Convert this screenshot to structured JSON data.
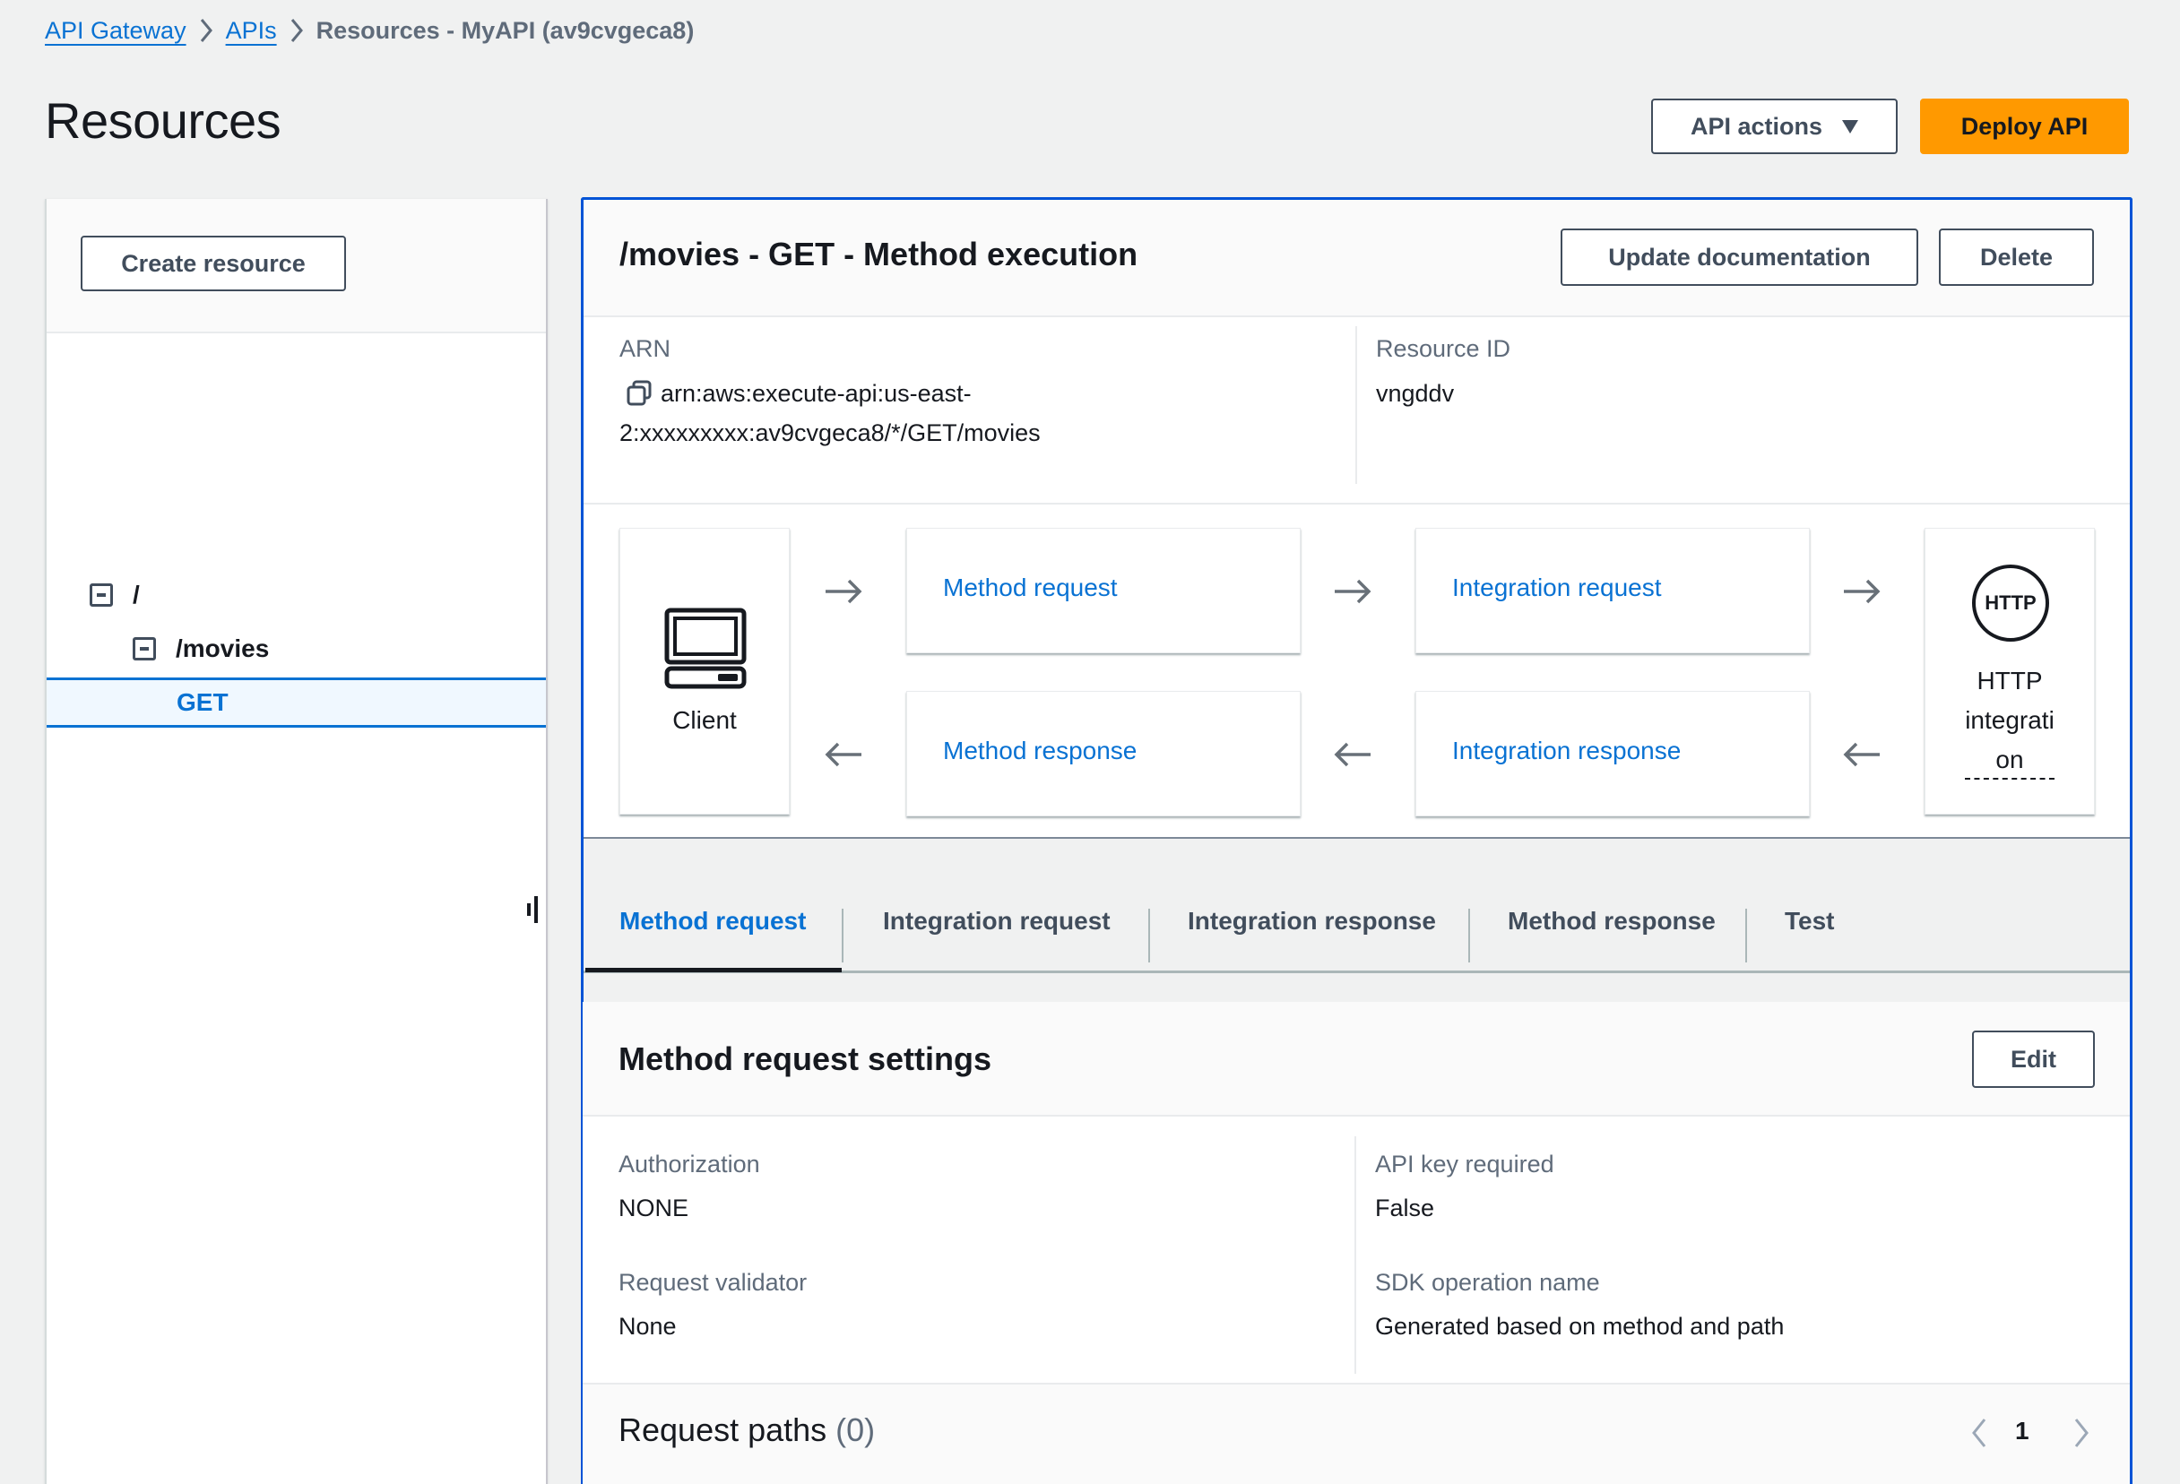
{
  "breadcrumb": {
    "items": [
      {
        "label": "API Gateway",
        "link": true
      },
      {
        "label": "APIs",
        "link": true
      },
      {
        "label": "Resources - MyAPI (av9cvgeca8)",
        "link": false
      }
    ]
  },
  "page": {
    "title": "Resources",
    "actions": {
      "api_actions_label": "API actions",
      "deploy_label": "Deploy API"
    }
  },
  "colors": {
    "accent": "#0972d3",
    "primary_button": "#ff9900",
    "panel_focus_border": "#0053d6"
  },
  "resource_tree": {
    "create_resource_label": "Create resource",
    "nodes": [
      {
        "label": "/",
        "expanded": true,
        "selected": false
      },
      {
        "label": "/movies",
        "expanded": true,
        "selected": false
      },
      {
        "label": "GET",
        "selected": true
      }
    ]
  },
  "method_execution": {
    "title": "/movies - GET - Method execution",
    "update_doc_label": "Update documentation",
    "delete_label": "Delete",
    "arn_label": "ARN",
    "arn_line1": "arn:aws:execute-api:us-east-",
    "arn_line2": "2:xxxxxxxxx:av9cvgeca8/*/GET/movies",
    "resource_id_label": "Resource ID",
    "resource_id_value": "vngddv",
    "flow": {
      "client_label": "Client",
      "method_request": "Method request",
      "integration_request": "Integration request",
      "method_response": "Method response",
      "integration_response": "Integration response",
      "http_badge": "HTTP",
      "http_line1": "HTTP",
      "http_line2": "integrati",
      "http_line3": "on"
    }
  },
  "tabs": [
    {
      "label": "Method request",
      "active": true
    },
    {
      "label": "Integration request",
      "active": false
    },
    {
      "label": "Integration response",
      "active": false
    },
    {
      "label": "Method response",
      "active": false
    },
    {
      "label": "Test",
      "active": false
    }
  ],
  "settings": {
    "title": "Method request settings",
    "edit_label": "Edit",
    "fields": {
      "authorization_label": "Authorization",
      "authorization_value": "NONE",
      "api_key_label": "API key required",
      "api_key_value": "False",
      "validator_label": "Request validator",
      "validator_value": "None",
      "sdk_label": "SDK operation name",
      "sdk_value": "Generated based on method and path"
    }
  },
  "request_paths": {
    "title": "Request paths",
    "count": "(0)",
    "current_page": "1"
  }
}
